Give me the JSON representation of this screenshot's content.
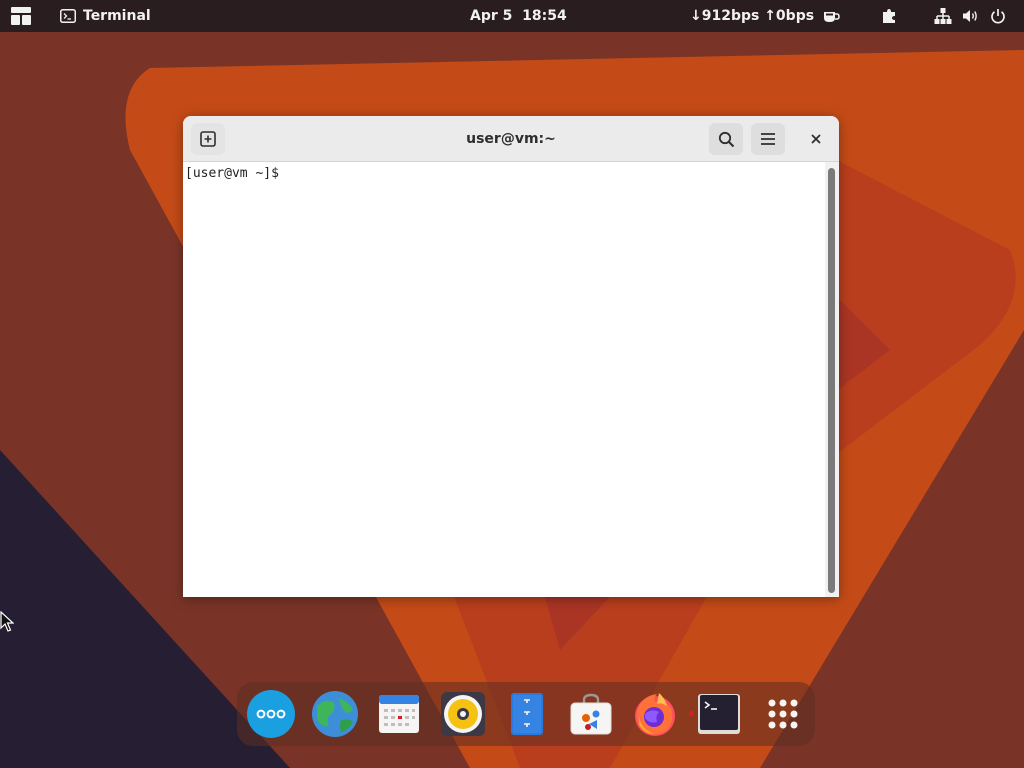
{
  "topbar": {
    "app_name": "Terminal",
    "clock": "Apr 5  18:54",
    "network_speed": "↓912bps ↑0bps",
    "icons": [
      "activities-icon",
      "terminal-app-icon",
      "coffee-icon",
      "extensions-icon",
      "network-icon",
      "volume-icon",
      "power-icon"
    ]
  },
  "window": {
    "title": "user@vm:~",
    "prompt": "[user@vm ~]$",
    "buttons": [
      "new-tab",
      "search",
      "menu",
      "close"
    ]
  },
  "dock": {
    "items": [
      "dots-app",
      "browser",
      "calendar",
      "rhythmbox",
      "text-editor",
      "software",
      "firefox",
      "terminal",
      "app-grid"
    ]
  },
  "colors": {
    "topbar": "#2a1d1f",
    "wallpaper_base": "#7a3427",
    "wallpaper_orange": "#c9501c",
    "headerbar": "#ebebeb",
    "accent_blue": "#1a9fe0"
  }
}
